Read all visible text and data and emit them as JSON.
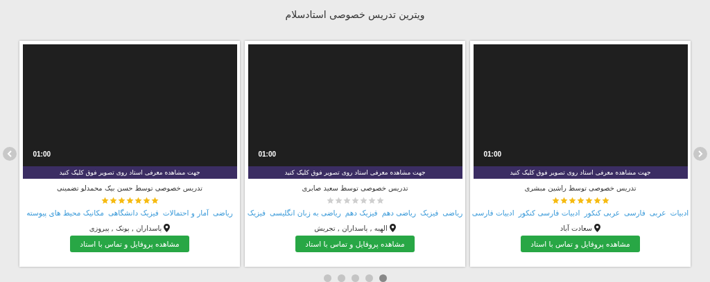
{
  "title": "ویترین تدریس خصوصی استادسلام",
  "cards": [
    {
      "duration": "01:00",
      "caption": "جهت مشاهده معرفی استاد روی تصویر فوق کلیک کنید",
      "name": "تدریس خصوصی توسط راشین مبشری",
      "stars": 7,
      "tags": [
        "ادبیات",
        "عربی",
        "فارسی",
        "عربی کنکور",
        "ادبیات فارسی کنکور",
        "ادبیات فارسی"
      ],
      "location": "سعادت آباد",
      "button": "مشاهده پروفایل و تماس با استاد"
    },
    {
      "duration": "01:00",
      "caption": "جهت مشاهده معرفی استاد روی تصویر فوق کلیک کنید",
      "name": "تدریس خصوصی توسط سعید صابری",
      "stars": 0,
      "tags": [
        "ریاضی",
        "فیزیک",
        "ریاضی دهم",
        "فیزیک دهم",
        "ریاضی به زبان انگلیسی",
        "فیزیک"
      ],
      "location": "الهیه , پاسداران , تجریش",
      "button": "مشاهده پروفایل و تماس با استاد"
    },
    {
      "duration": "01:00",
      "caption": "جهت مشاهده معرفی استاد روی تصویر فوق کلیک کنید",
      "name": "تدریس خصوصی توسط حسن بیک محمدلو تضمینی",
      "stars": 7,
      "tags": [
        "ریاضی",
        "آمار و احتمالات",
        "فیزیک دانشگاهی",
        "مکانیک محیط های پیوسته"
      ],
      "location": "پاسداران , پونک , پیروزی",
      "button": "مشاهده پروفایل و تماس با استاد"
    }
  ],
  "pager": [
    {
      "selected": true
    },
    {
      "selected": false
    },
    {
      "selected": false
    },
    {
      "selected": false
    },
    {
      "selected": false
    }
  ]
}
